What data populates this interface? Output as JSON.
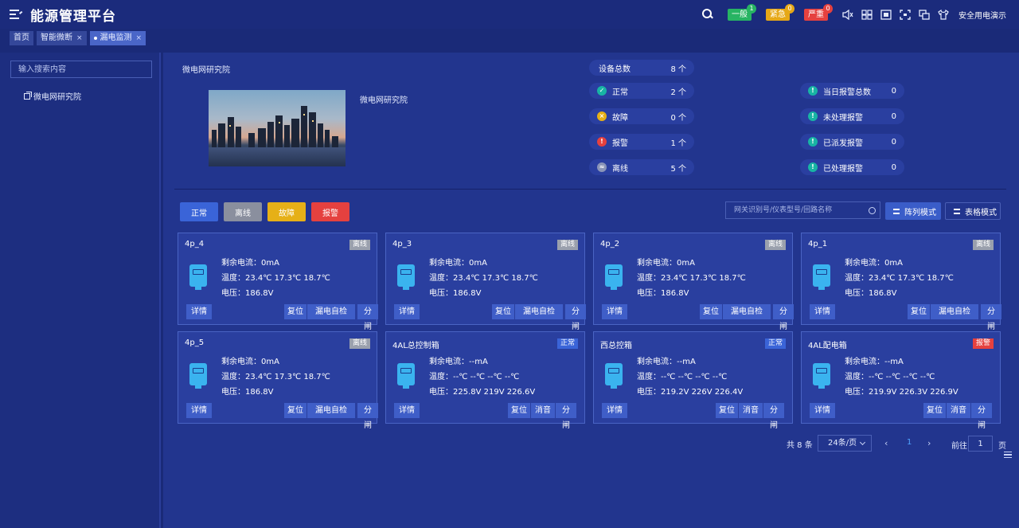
{
  "header": {
    "title": "能源管理平台",
    "alarms": [
      {
        "label": "一般",
        "count": "1",
        "bg": "#27b463",
        "dot": "#27b463"
      },
      {
        "label": "紧急",
        "count": "0",
        "bg": "#e6a817",
        "dot": "#e6a817"
      },
      {
        "label": "严重",
        "count": "0",
        "bg": "#e5413f",
        "dot": "#e5413f"
      }
    ],
    "user": "安全用电演示"
  },
  "tabs": [
    {
      "label": "首页"
    },
    {
      "label": "智能微断",
      "close": "×"
    },
    {
      "label": "漏电监测",
      "close": "×"
    }
  ],
  "sidebar": {
    "search_placeholder": "输入搜索内容",
    "tree_root": "微电网研究院"
  },
  "overview": {
    "station_name": "微电网研究院",
    "image_caption": "微电网研究院",
    "device_total": {
      "label": "设备总数",
      "value": "8 个"
    },
    "device_stats": [
      {
        "label": "正常",
        "value": "2 个",
        "icon": "✓",
        "color": "#18b4a4"
      },
      {
        "label": "故障",
        "value": "0 个",
        "icon": "×",
        "color": "#e6b017"
      },
      {
        "label": "报警",
        "value": "1 个",
        "icon": "!",
        "color": "#e5413f"
      },
      {
        "label": "离线",
        "value": "5 个",
        "icon": "≈",
        "color": "#8a95b8"
      }
    ],
    "alarm_stats": [
      {
        "label": "当日报警总数",
        "value": "0",
        "icon": "!",
        "color": "#18b4a4"
      },
      {
        "label": "未处理报警",
        "value": "0",
        "icon": "!",
        "color": "#18b4a4"
      },
      {
        "label": "已派发报警",
        "value": "0",
        "icon": "!",
        "color": "#18b4a4"
      },
      {
        "label": "已处理报警",
        "value": "0",
        "icon": "!",
        "color": "#18b4a4"
      }
    ]
  },
  "filters": [
    {
      "label": "正常",
      "bg": "#3a64d8"
    },
    {
      "label": "离线",
      "bg": "#8a8f9e"
    },
    {
      "label": "故障",
      "bg": "#e6b017"
    },
    {
      "label": "报警",
      "bg": "#e5413f"
    }
  ],
  "grid_search_placeholder": "网关识别号/仪表型号/回路名称",
  "view_modes": {
    "grid": "阵列模式",
    "table": "表格模式"
  },
  "devices": [
    {
      "name": "4p_4",
      "status": "离线",
      "status_bg": "#9aa0ad",
      "current": "剩余电流：0mA",
      "temp": "温度：23.4℃ 17.3℃ 18.7℃",
      "voltage": "电压：186.8V",
      "buttons": [
        "详情",
        "复位",
        "漏电自检",
        "分闸"
      ]
    },
    {
      "name": "4p_3",
      "status": "离线",
      "status_bg": "#9aa0ad",
      "current": "剩余电流：0mA",
      "temp": "温度：23.4℃ 17.3℃ 18.7℃",
      "voltage": "电压：186.8V",
      "buttons": [
        "详情",
        "复位",
        "漏电自检",
        "分闸"
      ]
    },
    {
      "name": "4p_2",
      "status": "离线",
      "status_bg": "#9aa0ad",
      "current": "剩余电流：0mA",
      "temp": "温度：23.4℃ 17.3℃ 18.7℃",
      "voltage": "电压：186.8V",
      "buttons": [
        "详情",
        "复位",
        "漏电自检",
        "分闸"
      ]
    },
    {
      "name": "4p_1",
      "status": "离线",
      "status_bg": "#9aa0ad",
      "current": "剩余电流：0mA",
      "temp": "温度：23.4℃ 17.3℃ 18.7℃",
      "voltage": "电压：186.8V",
      "buttons": [
        "详情",
        "复位",
        "漏电自检",
        "分闸"
      ]
    },
    {
      "name": "4p_5",
      "status": "离线",
      "status_bg": "#9aa0ad",
      "current": "剩余电流：0mA",
      "temp": "温度：23.4℃ 17.3℃ 18.7℃",
      "voltage": "电压：186.8V",
      "buttons": [
        "详情",
        "复位",
        "漏电自检",
        "分闸"
      ]
    },
    {
      "name": "4AL总控制箱",
      "status": "正常",
      "status_bg": "#3a64d8",
      "current": "剩余电流：--mA",
      "temp": "温度：--℃ --℃ --℃ --℃",
      "voltage": "电压：225.8V 219V 226.6V",
      "buttons": [
        "详情",
        "复位",
        "消音",
        "分闸"
      ]
    },
    {
      "name": "西总控箱",
      "status": "正常",
      "status_bg": "#3a64d8",
      "current": "剩余电流：--mA",
      "temp": "温度：--℃ --℃ --℃ --℃",
      "voltage": "电压：219.2V 226V 226.4V",
      "buttons": [
        "详情",
        "复位",
        "消音",
        "分闸"
      ]
    },
    {
      "name": "4AL配电箱",
      "status": "报警",
      "status_bg": "#e5413f",
      "current": "剩余电流：--mA",
      "temp": "温度：--℃ --℃ --℃ --℃",
      "voltage": "电压：219.9V 226.3V 226.9V",
      "buttons": [
        "详情",
        "复位",
        "消音",
        "分闸"
      ]
    }
  ],
  "pagination": {
    "total": "共 8 条",
    "page_size": "24条/页",
    "prev": "‹",
    "next": "›",
    "current_page": "1",
    "goto_label": "前往",
    "goto_value": "1",
    "page_unit": "页"
  }
}
